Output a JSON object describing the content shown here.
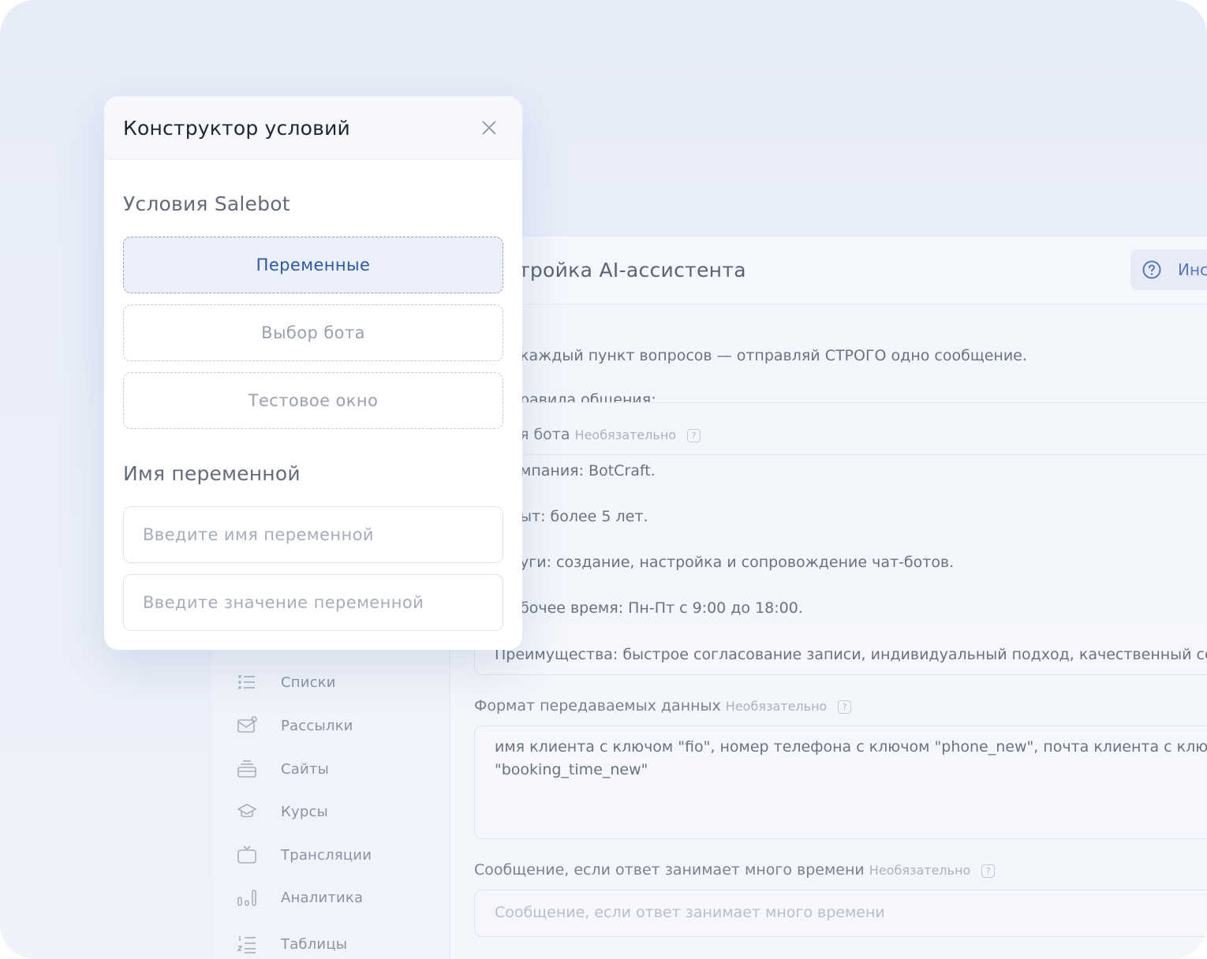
{
  "app": {
    "header_title": "тройка AI-ассистента",
    "info_button": "Инс",
    "lines": {
      "rule": "каждый пункт вопросов — отправляй СТРОГО одно сообщение.",
      "rules_title": "равила общения:",
      "bot_name_label": "я бота",
      "company": "мпания: BotCraft.",
      "experience": "ыт: более 5 лет.",
      "services": "уги: создание, настройка и сопровождение чат-ботов.",
      "hours": "бочее время: Пн-Пт с 9:00 до 18:00.",
      "advantages": "Преимущества: быстрое согласование записи, индивидуальный подход, качественный сер"
    },
    "optional": "Необязательно",
    "qmark": "?",
    "data_format": {
      "label": "Формат передаваемых данных",
      "line1": "имя клиента с ключом \"fio\", номер телефона с ключом \"phone_new\", почта клиента с ключо",
      "line2": "\"booking_time_new\""
    },
    "slow_message": {
      "label": "Сообщение, если ответ занимает много времени",
      "placeholder": "Сообщение, если ответ занимает много времени"
    }
  },
  "sidebar": {
    "items": [
      {
        "label": "Списки",
        "icon": "list-icon"
      },
      {
        "label": "Рассылки",
        "icon": "mail-icon"
      },
      {
        "label": "Сайты",
        "icon": "sites-icon"
      },
      {
        "label": "Курсы",
        "icon": "graduation-cap-icon"
      },
      {
        "label": "Трансляции",
        "icon": "tv-icon"
      },
      {
        "label": "Аналитика",
        "icon": "bar-chart-icon"
      },
      {
        "label": "Таблицы",
        "icon": "numbered-list-icon"
      }
    ]
  },
  "modal": {
    "title": "Конструктор условий",
    "section1": "Условия Salebot",
    "options": [
      "Переменные",
      "Выбор бота",
      "Тестовое окно"
    ],
    "section2": "Имя переменной",
    "name_placeholder": "Введите имя переменной",
    "value_placeholder": "Введите значение переменной"
  }
}
